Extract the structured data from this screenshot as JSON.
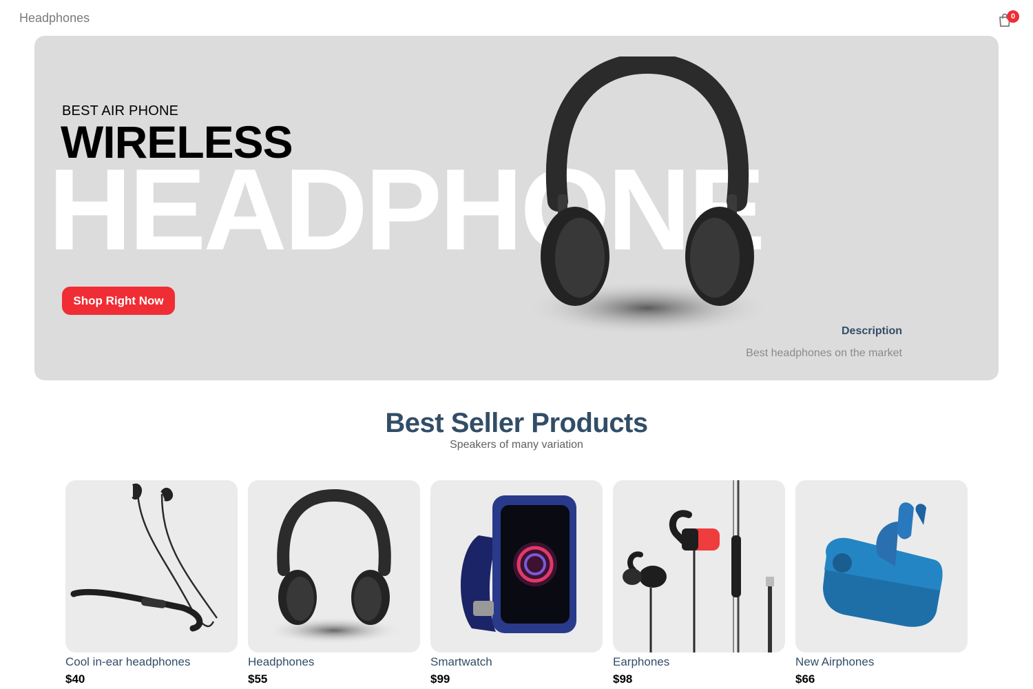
{
  "navbar": {
    "logo": "Headphones",
    "cart_qty": "0"
  },
  "hero": {
    "small_text": "BEST AIR PHONE",
    "mid_text": "WIRELESS",
    "large_text": "HEADPHONE",
    "button_label": "Shop Right Now",
    "desc_title": "Description",
    "desc_text": "Best headphones on the market"
  },
  "section": {
    "title": "Best Seller Products",
    "subtitle": "Speakers of many variation"
  },
  "products": [
    {
      "name": "Cool in-ear headphones",
      "price": "$40",
      "image": "neckband-earphones-icon"
    },
    {
      "name": "Headphones",
      "price": "$55",
      "image": "headphones-icon"
    },
    {
      "name": "Smartwatch",
      "price": "$99",
      "image": "smartwatch-icon"
    },
    {
      "name": "Earphones",
      "price": "$98",
      "image": "wired-earphones-icon"
    },
    {
      "name": "New Airphones",
      "price": "$66",
      "image": "wireless-earbuds-icon"
    }
  ],
  "colors": {
    "accent": "#f02d34",
    "heading": "#324d67",
    "banner_bg": "#dcdcdc",
    "card_bg": "#ebebeb"
  }
}
